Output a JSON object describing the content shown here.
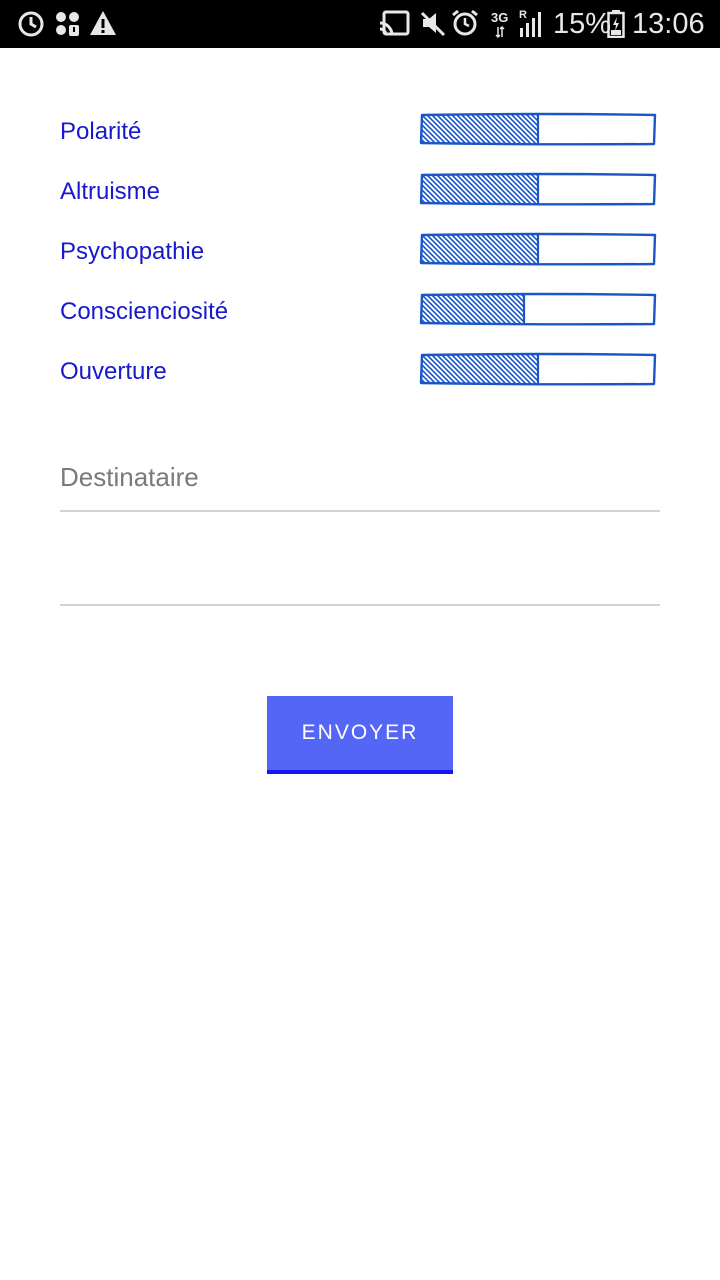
{
  "status_bar": {
    "battery_percent": "15%",
    "time": "13:06",
    "network_type": "3G",
    "roaming": "R",
    "icons": [
      "sync-icon",
      "grid-badge-icon",
      "warning-icon",
      "cast-icon",
      "mute-icon",
      "alarm-icon",
      "signal-icon",
      "battery-icon"
    ]
  },
  "traits": [
    {
      "label": "Polarité",
      "level": 0.5
    },
    {
      "label": "Altruisme",
      "level": 0.5
    },
    {
      "label": "Psychopathie",
      "level": 0.5
    },
    {
      "label": "Conscienciosité",
      "level": 0.44
    },
    {
      "label": "Ouverture",
      "level": 0.5
    }
  ],
  "form": {
    "recipient_placeholder": "Destinataire",
    "message_value": "",
    "send_label": "ENVOYER"
  },
  "colors": {
    "label_blue": "#1818cc",
    "bar_stroke": "#1a56c8",
    "button": "#5466f6",
    "button_underline": "#1616ee"
  }
}
